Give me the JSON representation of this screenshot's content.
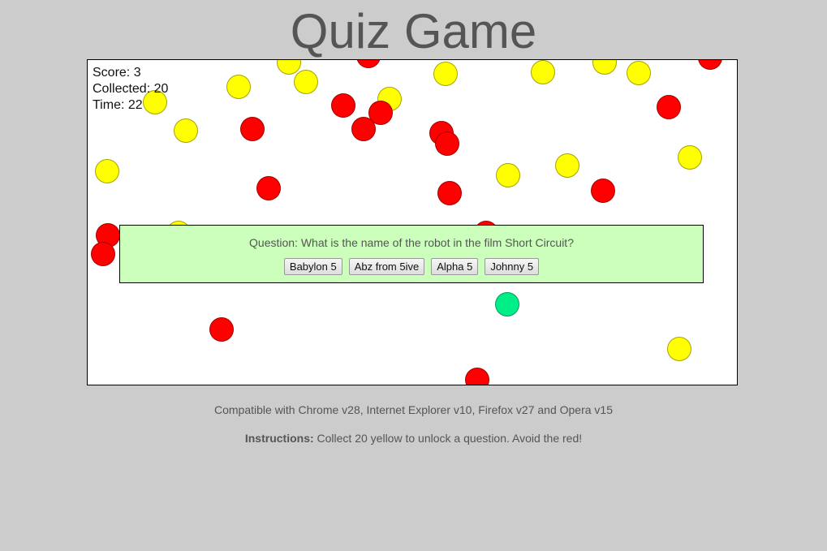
{
  "title": "Quiz Game",
  "hud": {
    "score_label": "Score: 3",
    "collected_label": "Collected: 20",
    "time_label": "Time: 22"
  },
  "question": {
    "text": "Question: What is the name of the robot in the film Short Circuit?",
    "answers": [
      "Babylon 5",
      "Abz from 5ive",
      "Alpha 5",
      "Johnny 5"
    ]
  },
  "footer": {
    "compatibility": "Compatible with Chrome v28, Internet Explorer v10, Firefox v27 and Opera v15",
    "instructions_label": "Instructions:",
    "instructions_text": " Collect 20 yellow to unlock a question. Avoid the red!"
  },
  "colors": {
    "yellow_ball": "#ffff00",
    "red_ball": "#ff0000",
    "player_ball": "#00ee88",
    "panel_bg": "#ccffbb"
  }
}
